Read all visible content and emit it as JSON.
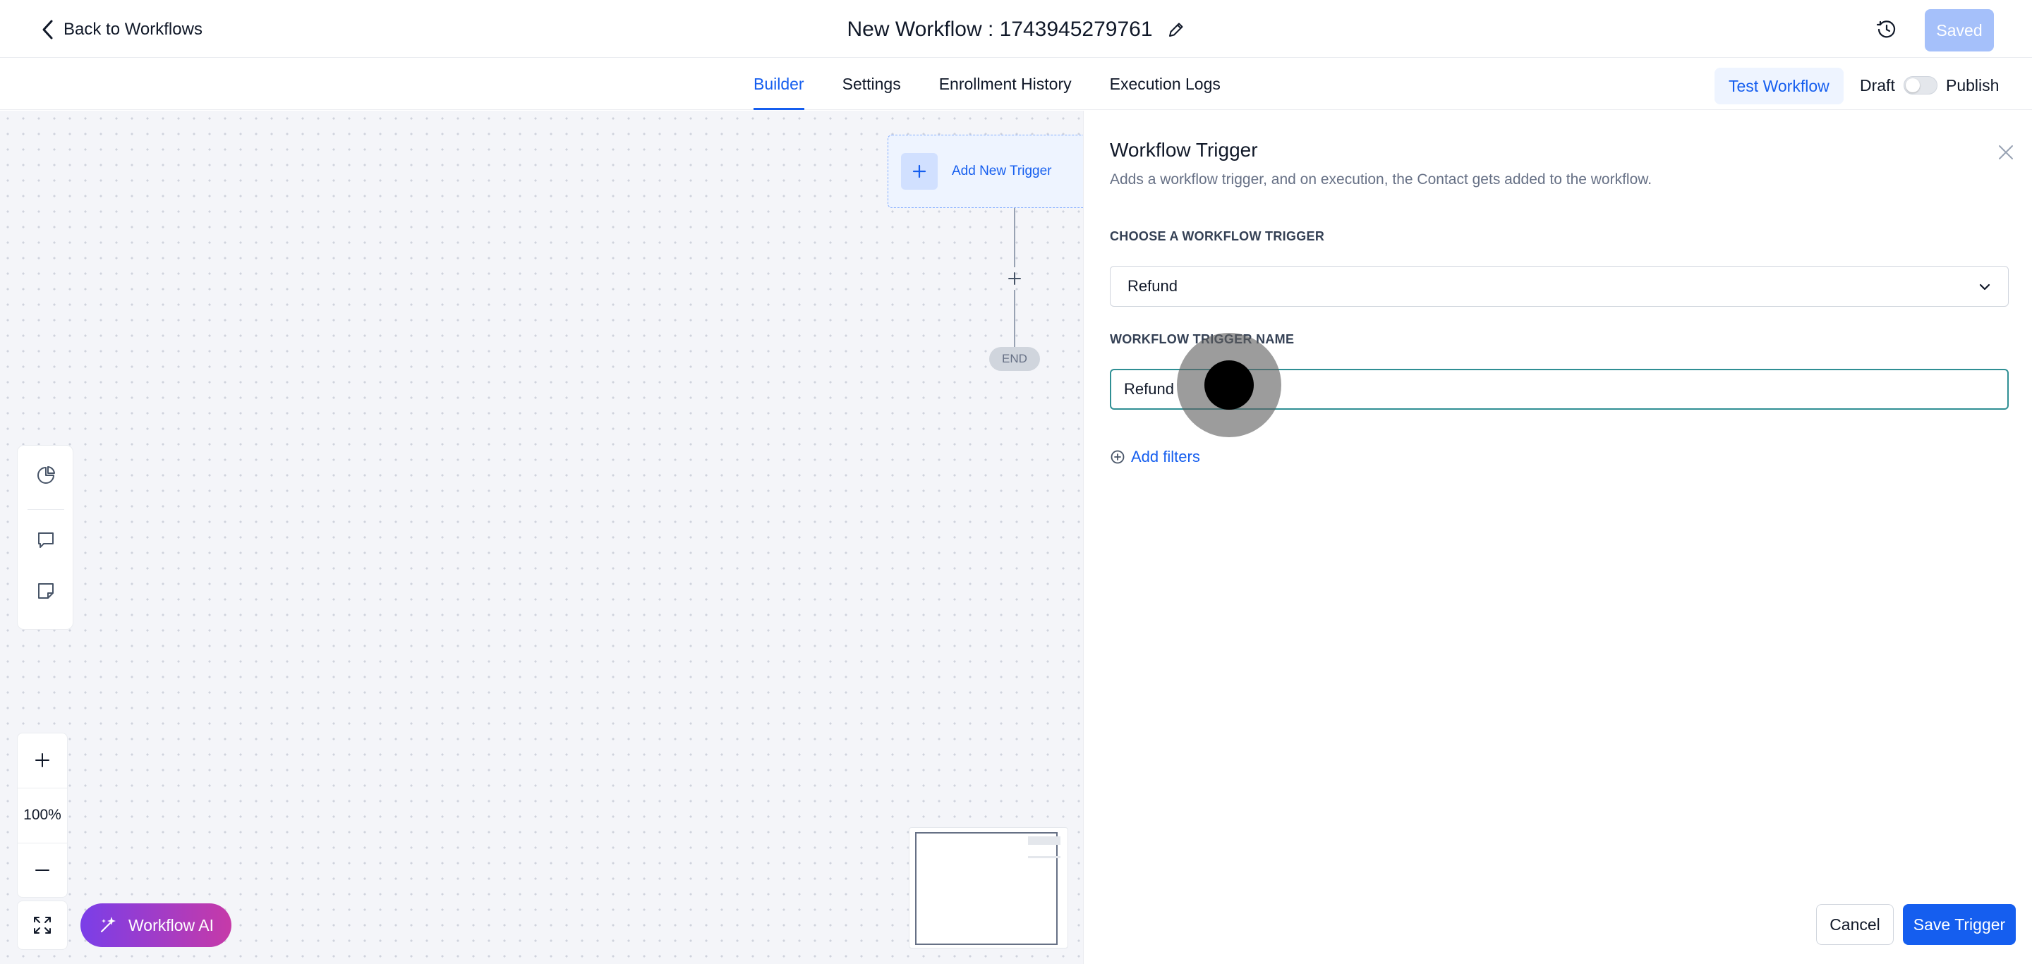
{
  "header": {
    "back_label": "Back to Workflows",
    "title": "New Workflow : 1743945279761",
    "saved_label": "Saved"
  },
  "tabs": [
    {
      "label": "Builder",
      "active": true
    },
    {
      "label": "Settings",
      "active": false
    },
    {
      "label": "Enrollment History",
      "active": false
    },
    {
      "label": "Execution Logs",
      "active": false
    }
  ],
  "actions": {
    "test_label": "Test Workflow",
    "draft_label": "Draft",
    "publish_label": "Publish",
    "publish_toggle_on": false
  },
  "canvas": {
    "add_trigger_label": "Add New Trigger",
    "end_label": "END",
    "zoom_level": "100%",
    "ai_label": "Workflow AI"
  },
  "panel": {
    "title": "Workflow Trigger",
    "description": "Adds a workflow trigger, and on execution, the Contact gets added to the workflow.",
    "choose_label": "CHOOSE A WORKFLOW TRIGGER",
    "selected_trigger": "Refund",
    "name_label": "WORKFLOW TRIGGER NAME",
    "name_value": "Refund",
    "add_filters_label": "Add filters",
    "cancel_label": "Cancel",
    "save_label": "Save Trigger"
  },
  "colors": {
    "primary": "#155eef",
    "saved_disabled": "#a5c0fa",
    "input_focus": "#2f8f94",
    "ai_gradient_start": "#7a3ee8",
    "ai_gradient_end": "#c63aa8"
  },
  "icons": {
    "back": "chevron-left-icon",
    "edit": "pencil-icon",
    "history": "clock-history-icon",
    "close": "close-icon",
    "dropdown": "chevron-down-icon",
    "add_filter": "plus-circle-icon",
    "ai": "sparkles-icon"
  }
}
